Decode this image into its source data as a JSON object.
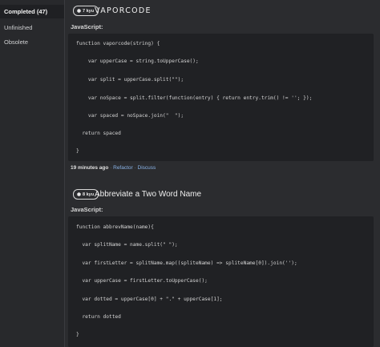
{
  "sidebar": {
    "items": [
      {
        "label": "Completed (47)"
      },
      {
        "label": "Unfinished"
      },
      {
        "label": "Obsolete"
      }
    ]
  },
  "katas": [
    {
      "rank": "7 kyu",
      "title": "VAPORCODE",
      "language": "JavaScript:",
      "time": "19 minutes ago",
      "refactor": "Refactor",
      "discuss": "Discuss",
      "sep": "·",
      "code_lines": [
        "function vaporcode(string) {",
        "    var upperCase = string.toUpperCase();",
        "    var split = upperCase.split(\"\");",
        "    var noSpace = split.filter(function(entry) { return entry.trim() != ''; });",
        "    var spaced = noSpace.join(\"  \");",
        "  return spaced",
        "}"
      ]
    },
    {
      "rank": "8 kyu",
      "title": "Abbreviate a Two Word Name",
      "language": "JavaScript:",
      "code_lines": [
        "function abbrevName(name){",
        "  var splitName = name.split(\" \");",
        "  var firstLetter = splitName.map((spliteName) => spliteName[0]).join('');",
        "  var upperCase = firstLetter.toUpperCase();",
        "  var dotted = upperCase[0] + \".\" + upperCase[1];",
        "  return dotted",
        "}"
      ]
    }
  ],
  "colors": {
    "background": "#2b2c2f",
    "code_background": "#202124",
    "link": "#8ab4e8"
  }
}
